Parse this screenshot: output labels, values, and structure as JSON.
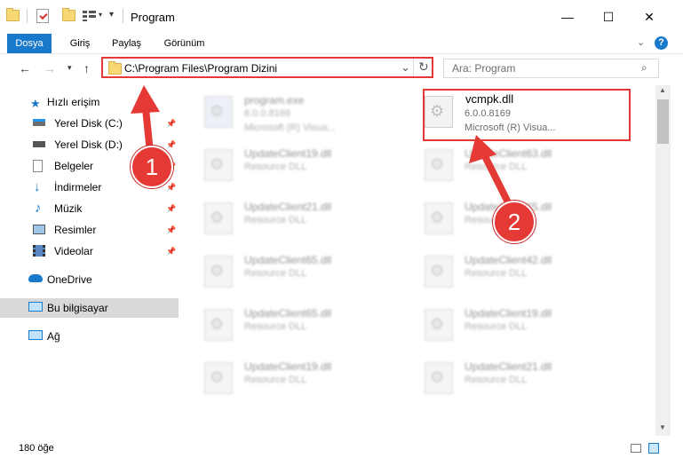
{
  "window": {
    "title": "Program"
  },
  "window_buttons": {
    "minimize": "—",
    "maximize": "☐",
    "close": "✕"
  },
  "ribbon": {
    "tabs": [
      {
        "label": "Dosya",
        "active": true
      },
      {
        "label": "Giriş"
      },
      {
        "label": "Paylaş"
      },
      {
        "label": "Görünüm"
      }
    ]
  },
  "address": {
    "path": "C:\\Program Files\\Program Dizini"
  },
  "search": {
    "placeholder": "Ara: Program"
  },
  "sidebar": {
    "items": [
      {
        "label": "Hızlı erişim",
        "icon": "star-icon"
      },
      {
        "label": "Yerel Disk (C:)",
        "icon": "drive-icon",
        "pinned": true
      },
      {
        "label": "Yerel Disk (D:)",
        "icon": "drive-icon",
        "pinned": true
      },
      {
        "label": "Belgeler",
        "icon": "documents-icon",
        "pinned": true
      },
      {
        "label": "İndirmeler",
        "icon": "download-icon",
        "pinned": true
      },
      {
        "label": "Müzik",
        "icon": "music-icon",
        "pinned": true
      },
      {
        "label": "Resimler",
        "icon": "pictures-icon",
        "pinned": true
      },
      {
        "label": "Videolar",
        "icon": "videos-icon",
        "pinned": true
      },
      {
        "label": "OneDrive",
        "icon": "cloud-icon"
      },
      {
        "label": "Bu bilgisayar",
        "icon": "computer-icon",
        "selected": true
      },
      {
        "label": "Ağ",
        "icon": "network-icon"
      }
    ]
  },
  "files": [
    {
      "name": "program.exe",
      "line2": "6.0.0.8169",
      "line3": "Microsoft (R) Visua..."
    },
    {
      "name": "vcmpk.dll",
      "line2": "6.0.0.8169",
      "line3": "Microsoft (R) Visua..."
    },
    {
      "name": "UpdateClient19.dll",
      "line2": "Resource DLL"
    },
    {
      "name": "UpdateClient63.dll",
      "line2": "Resource DLL"
    },
    {
      "name": "UpdateClient21.dll",
      "line2": "Resource DLL"
    },
    {
      "name": "UpdateClient65.dll",
      "line2": "Resource DLL"
    },
    {
      "name": "UpdateClient65.dll",
      "line2": "Resource DLL"
    },
    {
      "name": "UpdateClient42.dll",
      "line2": "Resource DLL"
    },
    {
      "name": "UpdateClient65.dll",
      "line2": "Resource DLL"
    },
    {
      "name": "UpdateClient19.dll",
      "line2": "Resource DLL"
    },
    {
      "name": "UpdateClient19.dll",
      "line2": "Resource DLL"
    },
    {
      "name": "UpdateClient21.dll",
      "line2": "Resource DLL"
    }
  ],
  "annotations": {
    "badge1": "1",
    "badge2": "2"
  },
  "status": {
    "count": "180 öğe"
  },
  "colors": {
    "accent": "#1979ca",
    "highlight": "#e53935"
  }
}
